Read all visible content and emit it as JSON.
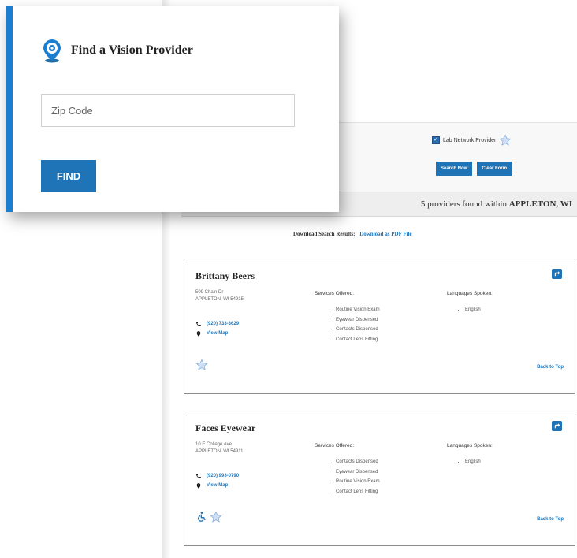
{
  "finder": {
    "title": "Find a Vision Provider",
    "zip_placeholder": "Zip Code",
    "find_label": "FIND"
  },
  "search": {
    "lab_network_label": "Lab Network Provider",
    "lab_network_checked": true,
    "search_now_label": "Search Now",
    "clear_form_label": "Clear Form"
  },
  "results": {
    "count": "5",
    "found_text": "providers found within",
    "location": "APPLETON, WI",
    "download_label": "Download Search Results:",
    "download_link": "Download as PDF File"
  },
  "providers": [
    {
      "name": "Brittany Beers",
      "address1": "509 Chain Dr",
      "address2": "APPLETON, WI 54915",
      "phone": "(920) 733-3629",
      "map_link": "View Map",
      "services_head": "Services Offered:",
      "services": [
        "Routine Vision Exam",
        "Eyewear Dispensed",
        "Contacts Dispensed",
        "Contact Lens Fitting"
      ],
      "languages_head": "Languages Spoken:",
      "languages": [
        "English"
      ],
      "back_to_top": "Back to Top",
      "icons": [
        "star-icon"
      ]
    },
    {
      "name": "Faces Eyewear",
      "address1": "10 E College Ave",
      "address2": "APPLETON, WI 54911",
      "phone": "(920) 993-0790",
      "map_link": "View Map",
      "services_head": "Services Offered:",
      "services": [
        "Contacts Dispensed",
        "Eyewear Dispensed",
        "Routine Vision Exam",
        "Contact Lens Fitting"
      ],
      "languages_head": "Languages Spoken:",
      "languages": [
        "English"
      ],
      "back_to_top": "Back to Top",
      "icons": [
        "wheelchair-icon",
        "star-icon"
      ]
    }
  ],
  "colors": {
    "accent": "#1f74b8",
    "modal_border": "#1a7fd0"
  }
}
